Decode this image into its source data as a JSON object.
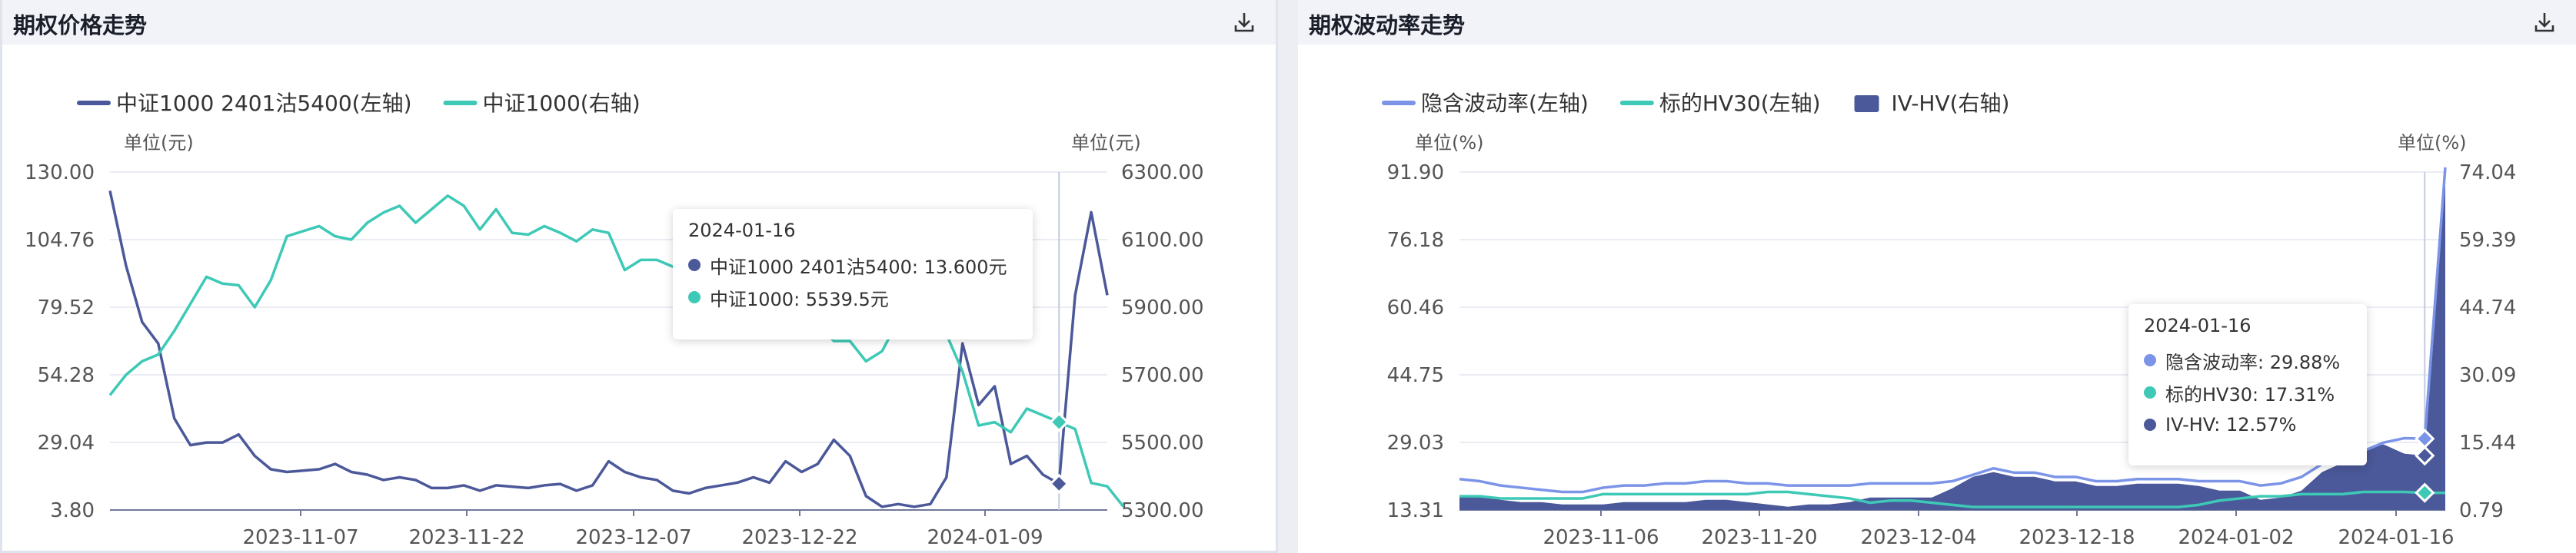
{
  "left_panel": {
    "title": "期权价格走势",
    "download_icon": "download-icon",
    "unit_left": "单位(元)",
    "unit_right": "单位(元)",
    "tooltip": {
      "date": "2024-01-16",
      "rows": [
        {
          "text": "中证1000 2401沽5400: 13.600元",
          "color": "#4b5899"
        },
        {
          "text": "中证1000: 5539.5元",
          "color": "#3ec9b6"
        }
      ]
    }
  },
  "right_panel": {
    "title": "期权波动率走势",
    "download_icon": "download-icon",
    "unit_left": "单位(%)",
    "unit_right": "单位(%)",
    "tooltip": {
      "date": "2024-01-16",
      "rows": [
        {
          "text": "隐含波动率: 29.88%",
          "color": "#7b94e8"
        },
        {
          "text": "标的HV30: 17.31%",
          "color": "#3ec9b6"
        },
        {
          "text": "IV-HV: 12.57%",
          "color": "#4b5899"
        }
      ]
    }
  },
  "chart_data": [
    {
      "type": "line",
      "title": "期权价格走势",
      "x_ticks": [
        "2023-11-07",
        "2023-11-22",
        "2023-12-07",
        "2023-12-22",
        "2024-01-09"
      ],
      "y_left": {
        "label": "单位(元)",
        "ticks": [
          "130.00",
          "104.76",
          "79.52",
          "54.28",
          "29.04",
          "3.80"
        ],
        "min": 3.8,
        "max": 130
      },
      "y_right": {
        "label": "单位(元)",
        "ticks": [
          "6300.00",
          "6100.00",
          "5900.00",
          "5700.00",
          "5500.00",
          "5300.00"
        ],
        "min": 5300,
        "max": 6300
      },
      "legend_position": "top-left",
      "series": [
        {
          "name": "中证1000 2401沽5400(左轴)",
          "axis": "left",
          "color": "#4b5899",
          "values": [
            123,
            95,
            74,
            66,
            38,
            28,
            29,
            29,
            32,
            24,
            19,
            18,
            18.5,
            19,
            21,
            18,
            17,
            15,
            16,
            15,
            12,
            12,
            13,
            11,
            13,
            12.5,
            12,
            13,
            13.5,
            11,
            13,
            22,
            18,
            16,
            15,
            11,
            10,
            12,
            13,
            14,
            16,
            14,
            22,
            18,
            21,
            30,
            24,
            9,
            5,
            6,
            5,
            6,
            16,
            66,
            43,
            50,
            21,
            24,
            17,
            13.6,
            84,
            115,
            84
          ]
        },
        {
          "name": "中证1000(右轴)",
          "axis": "right",
          "color": "#3ec9b6",
          "values": [
            5640,
            5700,
            5740,
            5760,
            5830,
            5910,
            5990,
            5970,
            5965,
            5900,
            5980,
            6110,
            6125,
            6140,
            6110,
            6100,
            6150,
            6180,
            6200,
            6150,
            6190,
            6230,
            6200,
            6130,
            6190,
            6120,
            6115,
            6140,
            6120,
            6095,
            6130,
            6120,
            6010,
            6040,
            6040,
            6020,
            6050,
            6010,
            6040,
            6010,
            5960,
            5970,
            5920,
            5820,
            5850,
            5800,
            5800,
            5740,
            5770,
            5860,
            5950,
            5880,
            5820,
            5710,
            5550,
            5560,
            5530,
            5600,
            5580,
            5560,
            5539.5,
            5380,
            5370,
            5310
          ]
        }
      ]
    },
    {
      "type": "line",
      "title": "期权波动率走势",
      "x_ticks": [
        "2023-11-06",
        "2023-11-20",
        "2023-12-04",
        "2023-12-18",
        "2024-01-02",
        "2024-01-16"
      ],
      "y_left": {
        "label": "单位(%)",
        "ticks": [
          "91.90",
          "76.18",
          "60.46",
          "44.75",
          "29.03",
          "13.31"
        ],
        "min": 13.31,
        "max": 91.9
      },
      "y_right": {
        "label": "单位(%)",
        "ticks": [
          "74.04",
          "59.39",
          "44.74",
          "30.09",
          "15.44",
          "0.79"
        ],
        "min": 0.79,
        "max": 74.04
      },
      "legend_position": "top-left",
      "series": [
        {
          "name": "隐含波动率(左轴)",
          "axis": "left",
          "type": "line",
          "color": "#7b94e8",
          "values": [
            20.5,
            20,
            19,
            18.5,
            18,
            17.5,
            17.5,
            18.5,
            19,
            19,
            19.5,
            19.5,
            20,
            20,
            19.5,
            19.5,
            19,
            19,
            19,
            19,
            19.5,
            19.5,
            19.5,
            19.5,
            20,
            21.5,
            23,
            22,
            22,
            21,
            21,
            20,
            20,
            20.5,
            20.5,
            20.5,
            20,
            20,
            20,
            19,
            19.5,
            21,
            24,
            24,
            27,
            29,
            30,
            29.88,
            93
          ]
        },
        {
          "name": "标的HV30(左轴)",
          "axis": "left",
          "type": "line",
          "color": "#3ec9b6",
          "values": [
            16.5,
            16.5,
            16,
            16,
            16,
            16,
            16,
            17,
            17,
            17,
            17,
            17,
            17,
            17,
            17,
            17.5,
            17.5,
            17,
            16.5,
            16,
            15,
            15.5,
            15.5,
            15,
            14.5,
            14,
            14,
            14,
            14,
            14,
            14,
            14,
            14,
            14,
            14,
            14,
            14.5,
            15.5,
            16,
            16.5,
            16.5,
            17,
            17,
            17,
            17.5,
            17.5,
            17.5,
            17.31,
            17.3
          ]
        },
        {
          "name": "IV-HV(右轴)",
          "axis": "right",
          "type": "area",
          "color": "#4b5899",
          "values": [
            4,
            4,
            3,
            2.5,
            2.5,
            2,
            2,
            2,
            2.5,
            2.5,
            2.5,
            2.5,
            3,
            3,
            2.5,
            2,
            1.5,
            2,
            2,
            2.5,
            3.5,
            3.5,
            3.5,
            3.5,
            5.5,
            8,
            9,
            8,
            8,
            7,
            7,
            6,
            6,
            6.5,
            6.5,
            6.5,
            6,
            5,
            5,
            3,
            3.5,
            5,
            9,
            11,
            14,
            15,
            13,
            12.57,
            72
          ]
        }
      ]
    }
  ]
}
